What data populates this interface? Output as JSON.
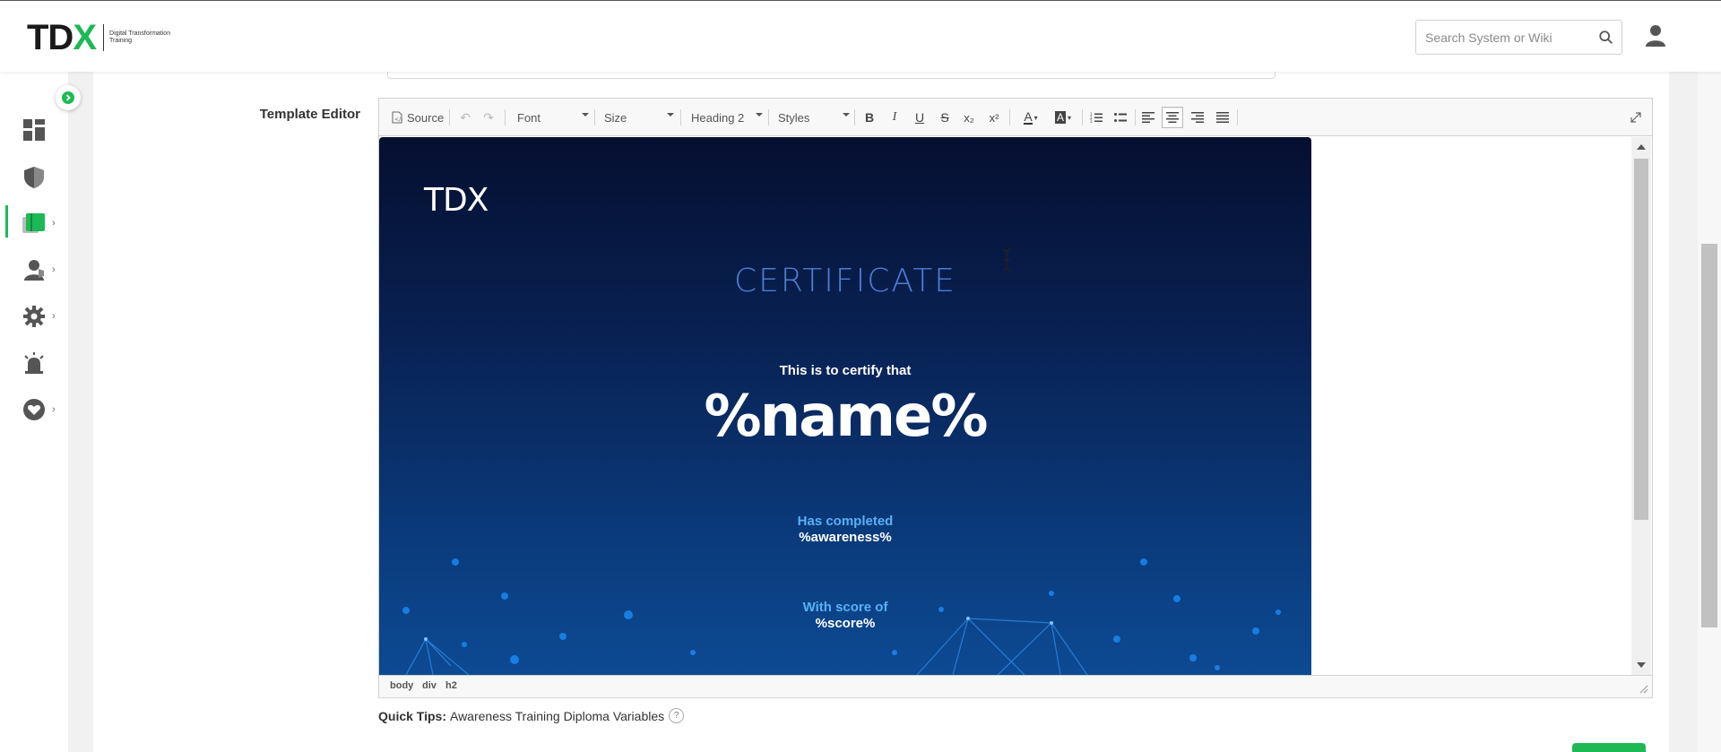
{
  "header": {
    "logo": {
      "part1": "TD",
      "part2": "X",
      "subtitle": "Digital Transformation Training"
    },
    "search": {
      "placeholder": "Search System or Wiki"
    }
  },
  "sidebar": {
    "items": [
      {
        "icon": "dashboard-icon"
      },
      {
        "icon": "shield-icon"
      },
      {
        "icon": "training-book-icon",
        "active": true,
        "has_submenu": true
      },
      {
        "icon": "user-group-icon",
        "has_submenu": true
      },
      {
        "icon": "gear-icon",
        "has_submenu": true
      },
      {
        "icon": "alarm-icon"
      },
      {
        "icon": "heart-icon",
        "has_submenu": true
      }
    ]
  },
  "form": {
    "template_editor_label": "Template Editor"
  },
  "toolbar": {
    "source_label": "Source",
    "font_label": "Font",
    "size_label": "Size",
    "format_label": "Heading 2",
    "styles_label": "Styles"
  },
  "certificate": {
    "logo": "TDX",
    "title": "CERTIFICATE",
    "certify_text": "This is to certify that",
    "name_var": "%name%",
    "completed_label": "Has completed",
    "awareness_var": "%awareness%",
    "score_label": "With score of",
    "score_var": "%score%"
  },
  "status_path": [
    "body",
    "div",
    "h2"
  ],
  "quick_tips": {
    "label": "Quick Tips:",
    "link": "Awareness Training Diploma Variables",
    "help": "?"
  },
  "colors": {
    "brand_green": "#1db954",
    "cert_title_blue": "#4e7dd1",
    "cert_label_blue": "#5ab0f5",
    "cert_bg_top": "#050f30",
    "cert_bg_bottom": "#0d4a93"
  }
}
